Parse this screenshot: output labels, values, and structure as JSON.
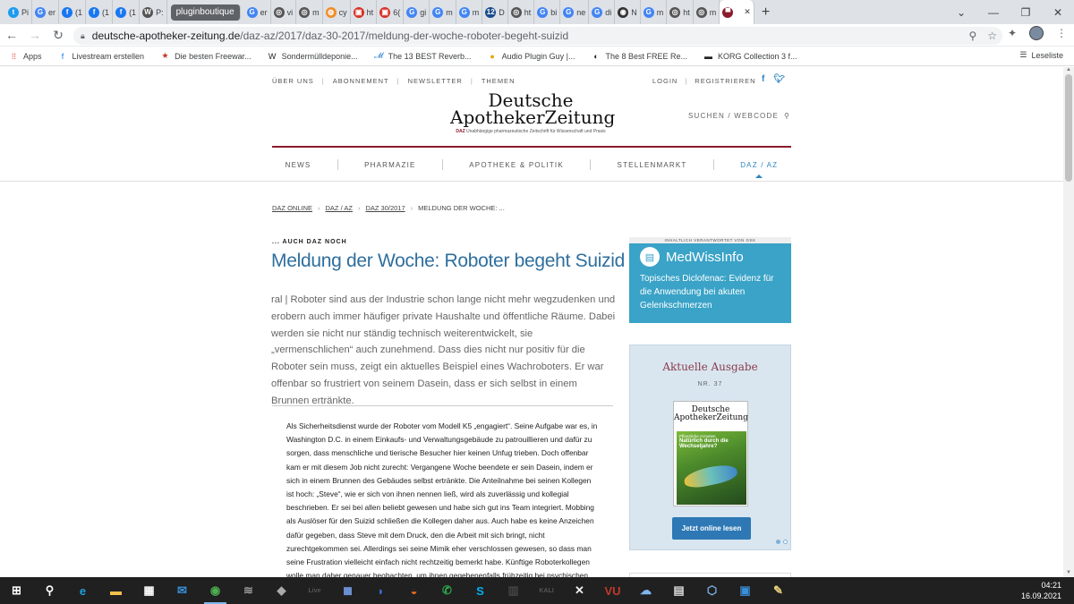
{
  "browser": {
    "tabs": [
      {
        "label": "Pi",
        "color": "#1d9bf0",
        "glyph": "t"
      },
      {
        "label": "er",
        "color": "#4285f4",
        "glyph": "G"
      },
      {
        "label": "(1",
        "color": "#1877f2",
        "glyph": "f"
      },
      {
        "label": "(1",
        "color": "#1877f2",
        "glyph": "f"
      },
      {
        "label": "(1",
        "color": "#1877f2",
        "glyph": "f"
      },
      {
        "label": "P:",
        "color": "#555",
        "glyph": "W"
      },
      {
        "label": "pluginboutique",
        "pill": true
      },
      {
        "label": "er",
        "color": "#4285f4",
        "glyph": "G"
      },
      {
        "label": "vi",
        "color": "#555",
        "glyph": "◎"
      },
      {
        "label": "m",
        "color": "#555",
        "glyph": "◎"
      },
      {
        "label": "cy",
        "color": "#f28c28",
        "glyph": "◍"
      },
      {
        "label": "ht",
        "color": "#d93025",
        "glyph": "▣"
      },
      {
        "label": "6(",
        "color": "#d93025",
        "glyph": "▣"
      },
      {
        "label": "gi",
        "color": "#4285f4",
        "glyph": "G"
      },
      {
        "label": "m",
        "color": "#4285f4",
        "glyph": "G"
      },
      {
        "label": "m",
        "color": "#4285f4",
        "glyph": "G"
      },
      {
        "label": "D",
        "color": "#1a4b8c",
        "glyph": "12"
      },
      {
        "label": "ht",
        "color": "#555",
        "glyph": "◎"
      },
      {
        "label": "bi",
        "color": "#4285f4",
        "glyph": "G"
      },
      {
        "label": "ne",
        "color": "#4285f4",
        "glyph": "G"
      },
      {
        "label": "di",
        "color": "#4285f4",
        "glyph": "G"
      },
      {
        "label": "N",
        "color": "#333",
        "glyph": "◉"
      },
      {
        "label": "m",
        "color": "#4285f4",
        "glyph": "G"
      },
      {
        "label": "ht",
        "color": "#555",
        "glyph": "◎"
      },
      {
        "label": "m",
        "color": "#555",
        "glyph": "◎"
      },
      {
        "label": "",
        "color": "#8b1a2b",
        "glyph": "▀",
        "active": true
      }
    ],
    "url_host": "deutsche-apotheker-zeitung.de",
    "url_path": "/daz-az/2017/daz-30-2017/meldung-der-woche-roboter-begeht-suizid",
    "bookmarks": [
      {
        "label": "Apps",
        "icon": "apps-icon",
        "glyph": "⁞⁞",
        "color": "#d93025"
      },
      {
        "label": "Livestream erstellen",
        "icon": "facebook-icon",
        "glyph": "f",
        "color": "#1877f2"
      },
      {
        "label": "Die besten Freewar...",
        "icon": "star-icon",
        "glyph": "★",
        "color": "#c0392b"
      },
      {
        "label": "Sondermülldeponie...",
        "icon": "w-icon",
        "glyph": "W",
        "color": "#222"
      },
      {
        "label": "The 13 BEST Reverb...",
        "icon": "leaf-icon",
        "glyph": "𝓜",
        "color": "#3b8bd6"
      },
      {
        "label": "Audio Plugin Guy |...",
        "icon": "plugin-guy-icon",
        "glyph": "●",
        "color": "#e0a800"
      },
      {
        "label": "The 8 Best FREE Re...",
        "icon": "music-icon",
        "glyph": "◐",
        "color": "#222"
      },
      {
        "label": "KORG Collection 3 f...",
        "icon": "korg-icon",
        "glyph": "▬",
        "color": "#222"
      }
    ],
    "reading_list": "Leseliste"
  },
  "site": {
    "topnav_left": [
      "ÜBER UNS",
      "ABONNEMENT",
      "NEWSLETTER",
      "THEMEN"
    ],
    "topnav_right": [
      "LOGIN",
      "REGISTRIEREN"
    ],
    "logo_line1": "Deutsche",
    "logo_line2": "ApothekerZeitung",
    "logo_tag_bold": "DAZ",
    "logo_tag": "Unabhängige pharmazeutische Zeitschrift für Wissenschaft und Praxis",
    "search_label": "SUCHEN / WEBCODE",
    "mainnav": [
      "NEWS",
      "PHARMAZIE",
      "APOTHEKE & POLITIK",
      "STELLENMARKT",
      "DAZ / AZ"
    ],
    "breadcrumb": [
      "DAZ ONLINE",
      "DAZ / AZ",
      "DAZ 30/2017",
      "MELDUNG DER WOCHE: ..."
    ]
  },
  "article": {
    "kicker": "... AUCH DAZ NOCH",
    "title": "Meldung der Woche: Roboter begeht Suizid",
    "lead": "ral | Roboter sind aus der Industrie schon lange nicht mehr wegzudenken und erobern auch immer häufiger private Haushalte und öffentliche Räume. Dabei werden sie nicht nur ständig technisch weiterentwickelt, sie „vermenschlichen“ auch zunehmend. Dass dies nicht nur positiv für die Roboter sein muss, zeigt ein aktuelles Beispiel eines Wachroboters. Er war offenbar so frustriert von seinem Dasein, dass er sich selbst in einem Brunnen ertränkte.",
    "body": "Als Sicherheitsdienst wurde der Roboter vom Modell K5 „engagiert“. Seine Aufgabe war es, in Washington D.C. in einem Einkaufs- und Verwaltungsgebäude zu patrouillieren und dafür zu sorgen, dass menschliche und tierische Besucher hier keinen Unfug trieben. Doch offenbar kam er mit diesem Job nicht zurecht: Vergangene Woche beendete er sein Dasein, indem er sich in einem Brunnen des Gebäudes selbst ertränkte. Die Anteilnahme bei seinen Kollegen ist hoch: „Steve“, wie er sich von ihnen nennen ließ, wird als zuverlässig und kollegial beschrieben. Er sei bei allen beliebt gewesen und habe sich gut ins Team integriert. Mobbing als Auslöser für den Suizid schließen die Kollegen daher aus. Auch habe es keine Anzeichen dafür gegeben, dass Steve mit dem Druck, den die Arbeit mit sich bringt, nicht zurechtgekommen sei. Allerdings sei seine Mimik eher verschlossen gewesen, so dass man seine Frustration vielleicht einfach nicht rechtzeitig bemerkt habe. Künftige Roboterkollegen wolle man daher genauer beobachten, um ihnen gegebenenfalls frühzeitig bei psychischen"
  },
  "sidebar": {
    "sponsor": "INHALTLICH VERANTWORTET VON GSK",
    "brand": "MedWissInfo",
    "teaser": "Topisches Diclofenac: Evidenz für die Anwendung bei akuten Gelenkschmerzen",
    "issue_title": "Aktuelle Ausgabe",
    "issue_number": "NR. 37",
    "cover_line1": "Deutsche",
    "cover_line2": "ApothekerZeitung",
    "cover_headline": "Natürlich durch die Wechseljahre?",
    "cover_kicker": "Pflanzliche Arzneien",
    "read_button": "Jetzt online lesen"
  },
  "taskbar": {
    "items": [
      {
        "name": "windows-start-icon",
        "glyph": "⊞",
        "color": "#fff"
      },
      {
        "name": "search-icon",
        "glyph": "⚲",
        "color": "#fff"
      },
      {
        "name": "edge-icon",
        "glyph": "e",
        "color": "#1fa0e0"
      },
      {
        "name": "file-explorer-icon",
        "glyph": "▬",
        "color": "#f2c14e"
      },
      {
        "name": "store-icon",
        "glyph": "▦",
        "color": "#fff"
      },
      {
        "name": "mail-icon",
        "glyph": "✉",
        "color": "#3a8fd8"
      },
      {
        "name": "chrome-icon",
        "glyph": "◉",
        "color": "#4caf50",
        "active": true
      },
      {
        "name": "app-icon",
        "glyph": "≋",
        "color": "#999"
      },
      {
        "name": "app-icon",
        "glyph": "◆",
        "color": "#aaa"
      },
      {
        "name": "ableton-live-icon",
        "glyph": "Live",
        "color": "#555"
      },
      {
        "name": "app-icon",
        "glyph": "◼",
        "color": "#6b8fd0"
      },
      {
        "name": "app-icon",
        "glyph": "◗",
        "color": "#3a6fd8"
      },
      {
        "name": "app-icon",
        "glyph": "◒",
        "color": "#e66b22"
      },
      {
        "name": "app-icon",
        "glyph": "✆",
        "color": "#2ba84a"
      },
      {
        "name": "skype-icon",
        "glyph": "S",
        "color": "#00aff0"
      },
      {
        "name": "app-icon",
        "glyph": "▥",
        "color": "#444"
      },
      {
        "name": "app-icon",
        "glyph": "KALI",
        "color": "#555"
      },
      {
        "name": "app-icon",
        "glyph": "✕",
        "color": "#eee"
      },
      {
        "name": "app-icon",
        "glyph": "VU",
        "color": "#c0392b"
      },
      {
        "name": "app-icon",
        "glyph": "☁",
        "color": "#7fb6ec"
      },
      {
        "name": "app-icon",
        "glyph": "▤",
        "color": "#ddd"
      },
      {
        "name": "app-icon",
        "glyph": "⬡",
        "color": "#7fb6ec"
      },
      {
        "name": "app-icon",
        "glyph": "▣",
        "color": "#3a8fd8"
      },
      {
        "name": "app-icon",
        "glyph": "✎",
        "color": "#e8d27a"
      }
    ],
    "time": "04:21",
    "date": "16.09.2021"
  }
}
